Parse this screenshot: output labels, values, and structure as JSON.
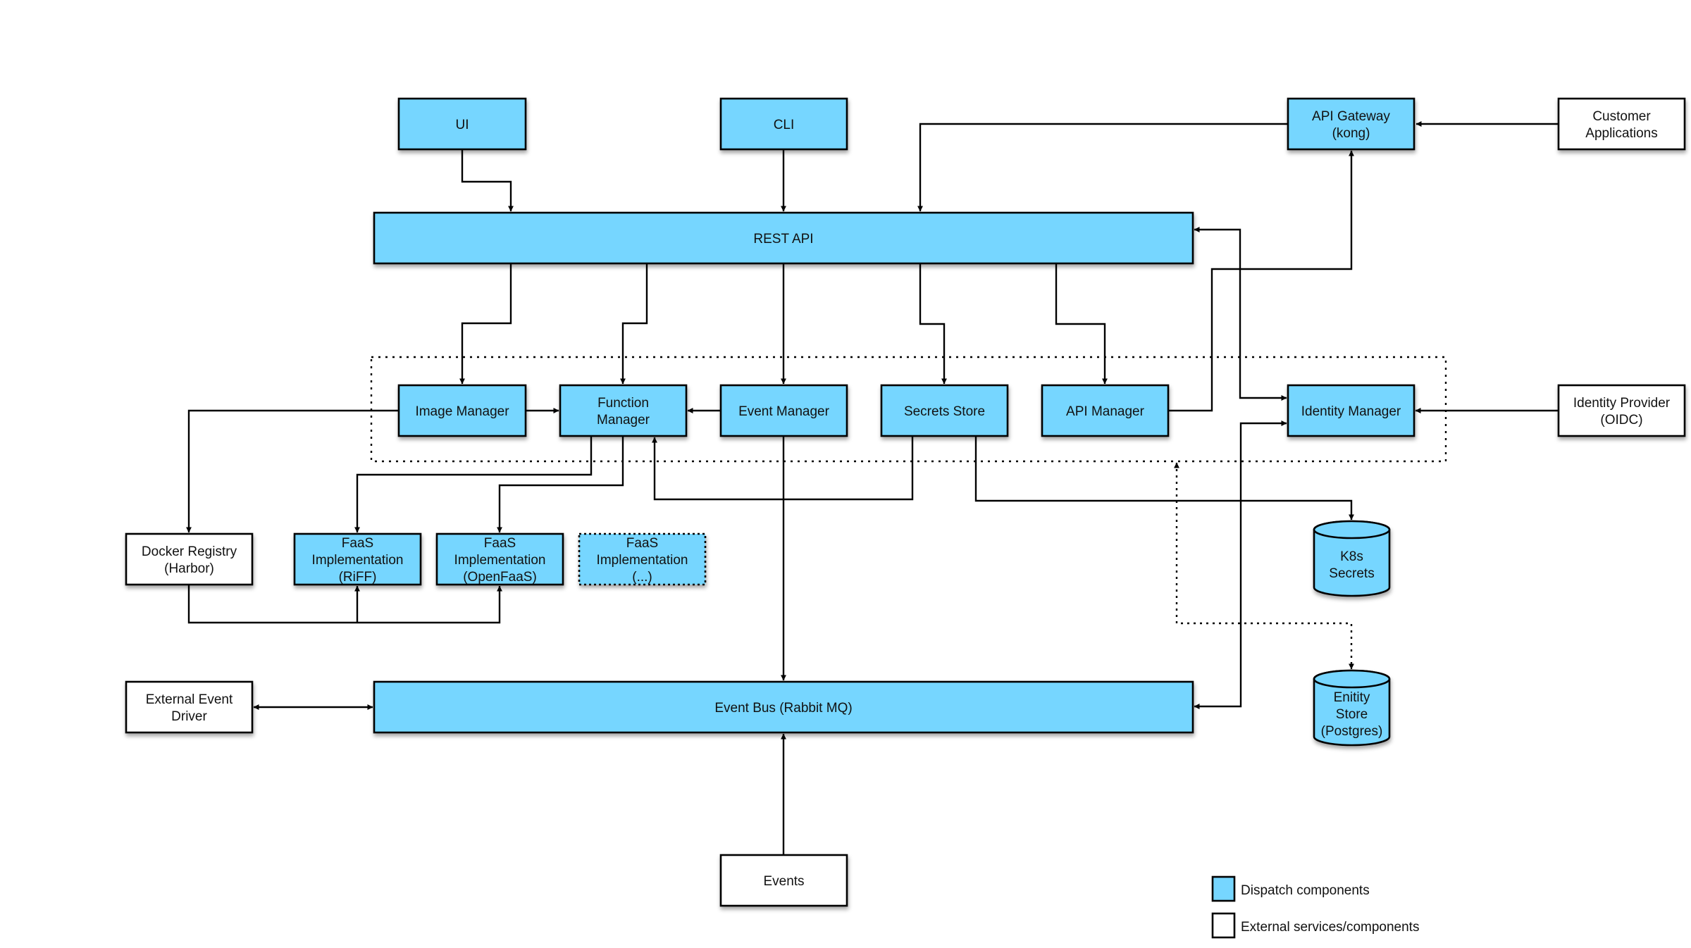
{
  "colors": {
    "dispatch": "#76D6FF",
    "external": "#FFFFFF",
    "stroke": "#000000"
  },
  "nodes": {
    "ui": {
      "lines": [
        "UI"
      ],
      "kind": "dispatch"
    },
    "cli": {
      "lines": [
        "CLI"
      ],
      "kind": "dispatch"
    },
    "api_gateway": {
      "lines": [
        "API Gateway",
        "(kong)"
      ],
      "kind": "dispatch"
    },
    "customer_apps": {
      "lines": [
        "Customer",
        "Applications"
      ],
      "kind": "external"
    },
    "rest_api": {
      "lines": [
        "REST API"
      ],
      "kind": "dispatch"
    },
    "image_manager": {
      "lines": [
        "Image Manager"
      ],
      "kind": "dispatch"
    },
    "function_manager": {
      "lines": [
        "Function",
        "Manager"
      ],
      "kind": "dispatch"
    },
    "event_manager": {
      "lines": [
        "Event Manager"
      ],
      "kind": "dispatch"
    },
    "secrets_store": {
      "lines": [
        "Secrets Store"
      ],
      "kind": "dispatch"
    },
    "api_manager": {
      "lines": [
        "API Manager"
      ],
      "kind": "dispatch"
    },
    "identity_manager": {
      "lines": [
        "Identity Manager"
      ],
      "kind": "dispatch"
    },
    "identity_provider": {
      "lines": [
        "Identity Provider",
        "(OIDC)"
      ],
      "kind": "external"
    },
    "docker_registry": {
      "lines": [
        "Docker Registry",
        "(Harbor)"
      ],
      "kind": "external"
    },
    "faas_riff": {
      "lines": [
        "FaaS",
        "Implementation",
        "(RiFF)"
      ],
      "kind": "dispatch"
    },
    "faas_openfaas": {
      "lines": [
        "FaaS",
        "Implementation",
        "(OpenFaaS)"
      ],
      "kind": "dispatch"
    },
    "faas_other": {
      "lines": [
        "FaaS",
        "Implementation",
        "(...)"
      ],
      "kind": "dispatch"
    },
    "k8s_secrets": {
      "lines": [
        "K8s",
        "Secrets"
      ],
      "kind": "dispatch"
    },
    "entity_store": {
      "lines": [
        "Enitity",
        "Store",
        "(Postgres)"
      ],
      "kind": "dispatch"
    },
    "external_event_driver": {
      "lines": [
        "External Event",
        "Driver"
      ],
      "kind": "external"
    },
    "event_bus": {
      "lines": [
        "Event Bus (Rabbit MQ)"
      ],
      "kind": "dispatch"
    },
    "events": {
      "lines": [
        "Events"
      ],
      "kind": "external"
    }
  },
  "edges": [
    {
      "from": "ui",
      "to": "rest_api"
    },
    {
      "from": "cli",
      "to": "rest_api"
    },
    {
      "from": "api_gateway",
      "to": "rest_api"
    },
    {
      "from": "customer_apps",
      "to": "api_gateway"
    },
    {
      "from": "rest_api",
      "to": "image_manager"
    },
    {
      "from": "rest_api",
      "to": "function_manager"
    },
    {
      "from": "rest_api",
      "to": "event_manager"
    },
    {
      "from": "rest_api",
      "to": "secrets_store"
    },
    {
      "from": "rest_api",
      "to": "api_manager"
    },
    {
      "from": "rest_api",
      "to": "identity_manager",
      "bidirectional": true
    },
    {
      "from": "api_manager",
      "to": "api_gateway"
    },
    {
      "from": "image_manager",
      "to": "function_manager"
    },
    {
      "from": "event_manager",
      "to": "function_manager"
    },
    {
      "from": "identity_provider",
      "to": "identity_manager"
    },
    {
      "from": "image_manager",
      "to": "docker_registry"
    },
    {
      "from": "function_manager",
      "to": "faas_riff"
    },
    {
      "from": "function_manager",
      "to": "faas_openfaas"
    },
    {
      "from": "docker_registry",
      "to": "faas_riff"
    },
    {
      "from": "docker_registry",
      "to": "faas_openfaas"
    },
    {
      "from": "secrets_store",
      "to": "function_manager"
    },
    {
      "from": "secrets_store",
      "to": "k8s_secrets"
    },
    {
      "from": "event_manager",
      "to": "event_bus"
    },
    {
      "from": "event_bus",
      "to": "identity_manager",
      "bidirectional": true
    },
    {
      "from": "external_event_driver",
      "to": "event_bus",
      "bidirectional": true
    },
    {
      "from": "events",
      "to": "event_bus"
    },
    {
      "from": "entity_store",
      "to": "dispatch_components_group",
      "bidirectional": true,
      "style": "dotted"
    }
  ],
  "legend": [
    {
      "label": "Dispatch components",
      "kind": "dispatch"
    },
    {
      "label": "External services/components",
      "kind": "external"
    }
  ]
}
